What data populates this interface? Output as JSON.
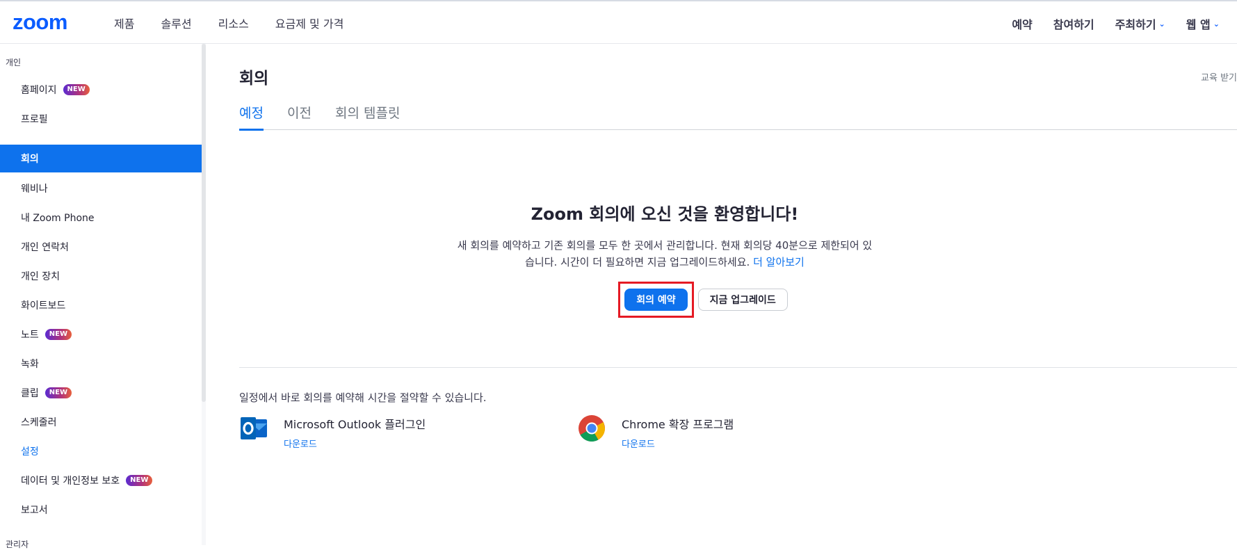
{
  "header": {
    "logo": "zoom",
    "nav_left": [
      "제품",
      "솔루션",
      "리소스",
      "요금제 및 가격"
    ],
    "nav_right": [
      {
        "label": "예약",
        "dropdown": false
      },
      {
        "label": "참여하기",
        "dropdown": false
      },
      {
        "label": "주최하기",
        "dropdown": true
      },
      {
        "label": "웹 앱",
        "dropdown": true
      }
    ]
  },
  "sidebar": {
    "section_personal": "개인",
    "section_admin": "관리자",
    "new_badge": "NEW",
    "items": [
      {
        "label": "홈페이지",
        "new": true,
        "active": false
      },
      {
        "label": "프로필",
        "new": false,
        "active": false
      },
      {
        "label": "회의",
        "new": false,
        "active": true
      },
      {
        "label": "웨비나",
        "new": false,
        "active": false
      },
      {
        "label": "내 Zoom Phone",
        "new": false,
        "active": false
      },
      {
        "label": "개인 연락처",
        "new": false,
        "active": false
      },
      {
        "label": "개인 장치",
        "new": false,
        "active": false
      },
      {
        "label": "화이트보드",
        "new": false,
        "active": false
      },
      {
        "label": "노트",
        "new": true,
        "active": false
      },
      {
        "label": "녹화",
        "new": false,
        "active": false
      },
      {
        "label": "클립",
        "new": true,
        "active": false
      },
      {
        "label": "스케줄러",
        "new": false,
        "active": false
      },
      {
        "label": "설정",
        "new": false,
        "active": false,
        "highlight": true
      },
      {
        "label": "데이터 및 개인정보 보호",
        "new": true,
        "active": false
      },
      {
        "label": "보고서",
        "new": false,
        "active": false
      }
    ]
  },
  "main": {
    "title": "회의",
    "training_link": "교육 받기",
    "tabs": [
      {
        "label": "예정",
        "active": true
      },
      {
        "label": "이전",
        "active": false
      },
      {
        "label": "회의 템플릿",
        "active": false
      }
    ],
    "welcome_title": "Zoom 회의에 오신 것을 환영합니다!",
    "welcome_desc": "새 회의를 예약하고 기존 회의를 모두 한 곳에서 관리합니다. 현재 회의당 40분으로 제한되어 있습니다. 시간이 더 필요하면 지금 업그레이드하세요.",
    "learn_more": "더 알아보기",
    "schedule_button": "회의 예약",
    "upgrade_button": "지금 업그레이드",
    "calendar_hint": "일정에서 바로 회의를 예약해 시간을 절약할 수 있습니다.",
    "integrations": [
      {
        "name": "Microsoft Outlook 플러그인",
        "download": "다운로드",
        "icon": "outlook-icon"
      },
      {
        "name": "Chrome 확장 프로그램",
        "download": "다운로드",
        "icon": "chrome-icon"
      }
    ]
  },
  "colors": {
    "brand": "#0b5cff",
    "accent": "#0e72ed",
    "highlight_box": "#e51a24"
  }
}
